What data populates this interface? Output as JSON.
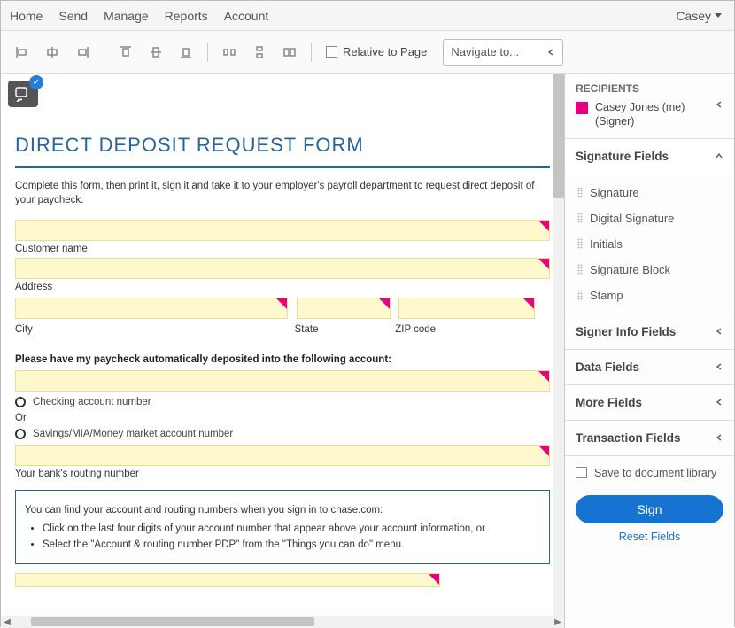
{
  "topnav": {
    "items": [
      "Home",
      "Send",
      "Manage",
      "Reports",
      "Account"
    ],
    "user": "Casey"
  },
  "toolbar": {
    "relative_label": "Relative to Page",
    "navigate_placeholder": "Navigate to..."
  },
  "doc": {
    "title": "DIRECT DEPOSIT REQUEST FORM",
    "intro": "Complete this form, then print it, sign it and take it to your employer's payroll department to request direct deposit of your paycheck.",
    "labels": {
      "customer_name": "Customer name",
      "address": "Address",
      "city": "City",
      "state": "State",
      "zip": "ZIP code",
      "section": "Please have my paycheck automatically deposited into the following account:",
      "checking": "Checking account number",
      "or": "Or",
      "savings": "Savings/MIA/Money market account number",
      "routing": "Your bank's routing number"
    },
    "info": {
      "lead": "You can find your account and routing numbers when you sign in to chase.com:",
      "b1": "Click on the last four digits of your account number that appear above your account information, or",
      "b2": "Select the \"Account & routing number PDP\" from the \"Things you can do\" menu."
    }
  },
  "side": {
    "recipients_heading": "RECIPIENTS",
    "recipient_name": "Casey Jones (me)",
    "recipient_role": "(Signer)",
    "groups": {
      "signature": "Signature Fields",
      "signer_info": "Signer Info Fields",
      "data": "Data Fields",
      "more": "More Fields",
      "transaction": "Transaction Fields"
    },
    "signature_items": [
      "Signature",
      "Digital Signature",
      "Initials",
      "Signature Block",
      "Stamp"
    ],
    "save_label": "Save to document library",
    "sign_label": "Sign",
    "reset_label": "Reset Fields"
  }
}
